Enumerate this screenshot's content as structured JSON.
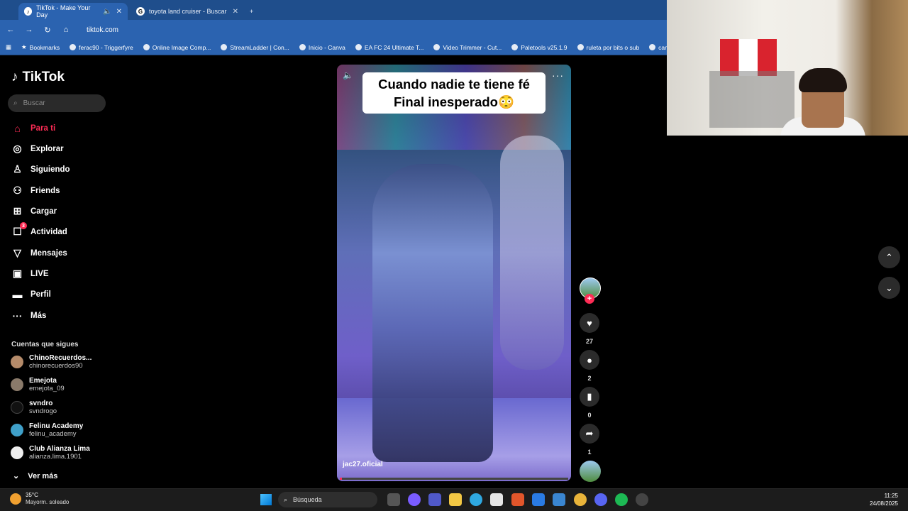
{
  "browser": {
    "tabs": [
      {
        "title": "TikTok - Make Your Day",
        "active": true
      },
      {
        "title": "toyota land cruiser - Buscar con",
        "active": false
      }
    ],
    "url": "tiktok.com",
    "bookmarks": [
      "Bookmarks",
      "ferac90 - Triggerfyre",
      "Online Image Comp...",
      "StreamLadder | Con...",
      "Inicio - Canva",
      "EA FC 24 Ultimate T...",
      "Video Trimmer - Cut...",
      "Paletools v25.1.9",
      "ruleta por bits o sub",
      "camara cel"
    ]
  },
  "sidebar": {
    "logo": "TikTok",
    "search_placeholder": "Buscar",
    "nav": [
      {
        "label": "Para ti",
        "icon": "home-icon",
        "active": true
      },
      {
        "label": "Explorar",
        "icon": "compass-icon"
      },
      {
        "label": "Siguiendo",
        "icon": "user-following-icon"
      },
      {
        "label": "Friends",
        "icon": "friends-icon"
      },
      {
        "label": "Cargar",
        "icon": "upload-icon"
      },
      {
        "label": "Actividad",
        "icon": "activity-icon",
        "badge": "3"
      },
      {
        "label": "Mensajes",
        "icon": "messages-icon"
      },
      {
        "label": "LIVE",
        "icon": "live-icon"
      },
      {
        "label": "Perfil",
        "icon": "profile-icon"
      },
      {
        "label": "Más",
        "icon": "more-icon"
      }
    ],
    "following_title": "Cuentas que sigues",
    "accounts": [
      {
        "name": "ChinoRecuerdos...",
        "handle": "chinorecuerdos90"
      },
      {
        "name": "Emejota",
        "handle": "emejota_09"
      },
      {
        "name": "svndro",
        "handle": "svndrogo"
      },
      {
        "name": "Felinu Academy",
        "handle": "felinu_academy"
      },
      {
        "name": "Club Alianza Lima",
        "handle": "alianza.lima.1901"
      }
    ],
    "see_more": "Ver más"
  },
  "video": {
    "caption_line1": "Cuando nadie te tiene fé",
    "caption_line2": "Final inesperado😳",
    "author": "jac27.oficial",
    "progress": 0.01
  },
  "actions": {
    "likes": "27",
    "comments": "2",
    "saves": "0",
    "shares": "1"
  },
  "taskbar": {
    "temperature": "35°C",
    "weather": "Mayorm. soleado",
    "search": "Búsqueda",
    "time": "11:25",
    "date": "24/08/2025"
  },
  "colors": {
    "accent": "#fe2c55",
    "chrome": "#2b63b0"
  }
}
